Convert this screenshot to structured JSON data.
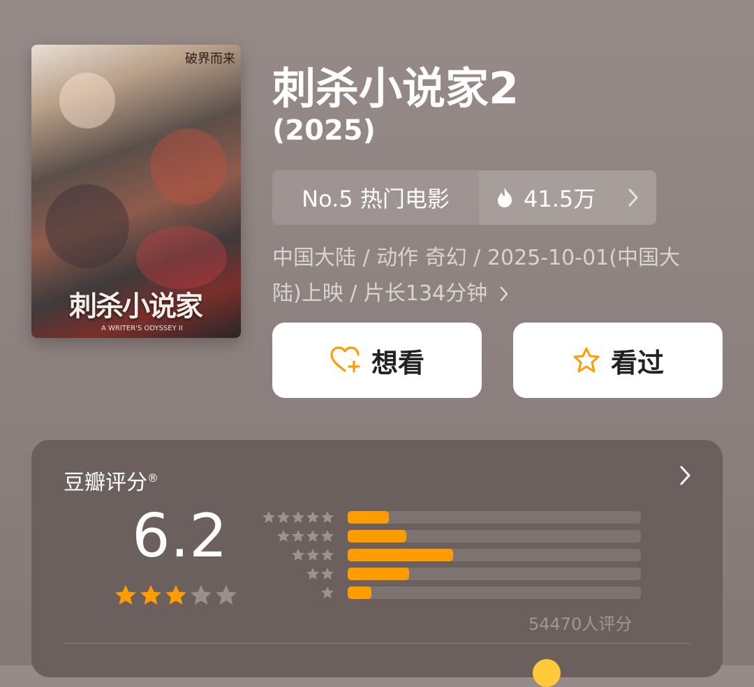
{
  "poster": {
    "tagline": "破界而来",
    "title_art": "刺杀小说家",
    "subtitle": "A WRITER'S ODYSSEY II"
  },
  "movie": {
    "title": "刺杀小说家2",
    "year": "(2025)"
  },
  "ranking": {
    "label": "No.5 热门电影",
    "hot_count": "41.5万",
    "icon": "flame-icon"
  },
  "meta_line1": "中国大陆 / 动作 奇幻 / 2025-10-01(中国大",
  "meta_line2": "陆)上映 / 片长134分钟",
  "actions": {
    "want_label": "想看",
    "seen_label": "看过"
  },
  "rating": {
    "title": "豆瓣评分",
    "reg": "®",
    "score": "6.2",
    "stars_filled": 3,
    "stars_total": 5,
    "distribution_percent": [
      14,
      20,
      36,
      21,
      8
    ],
    "count_text": "54470人评分",
    "accent_color": "#ff9d00"
  }
}
